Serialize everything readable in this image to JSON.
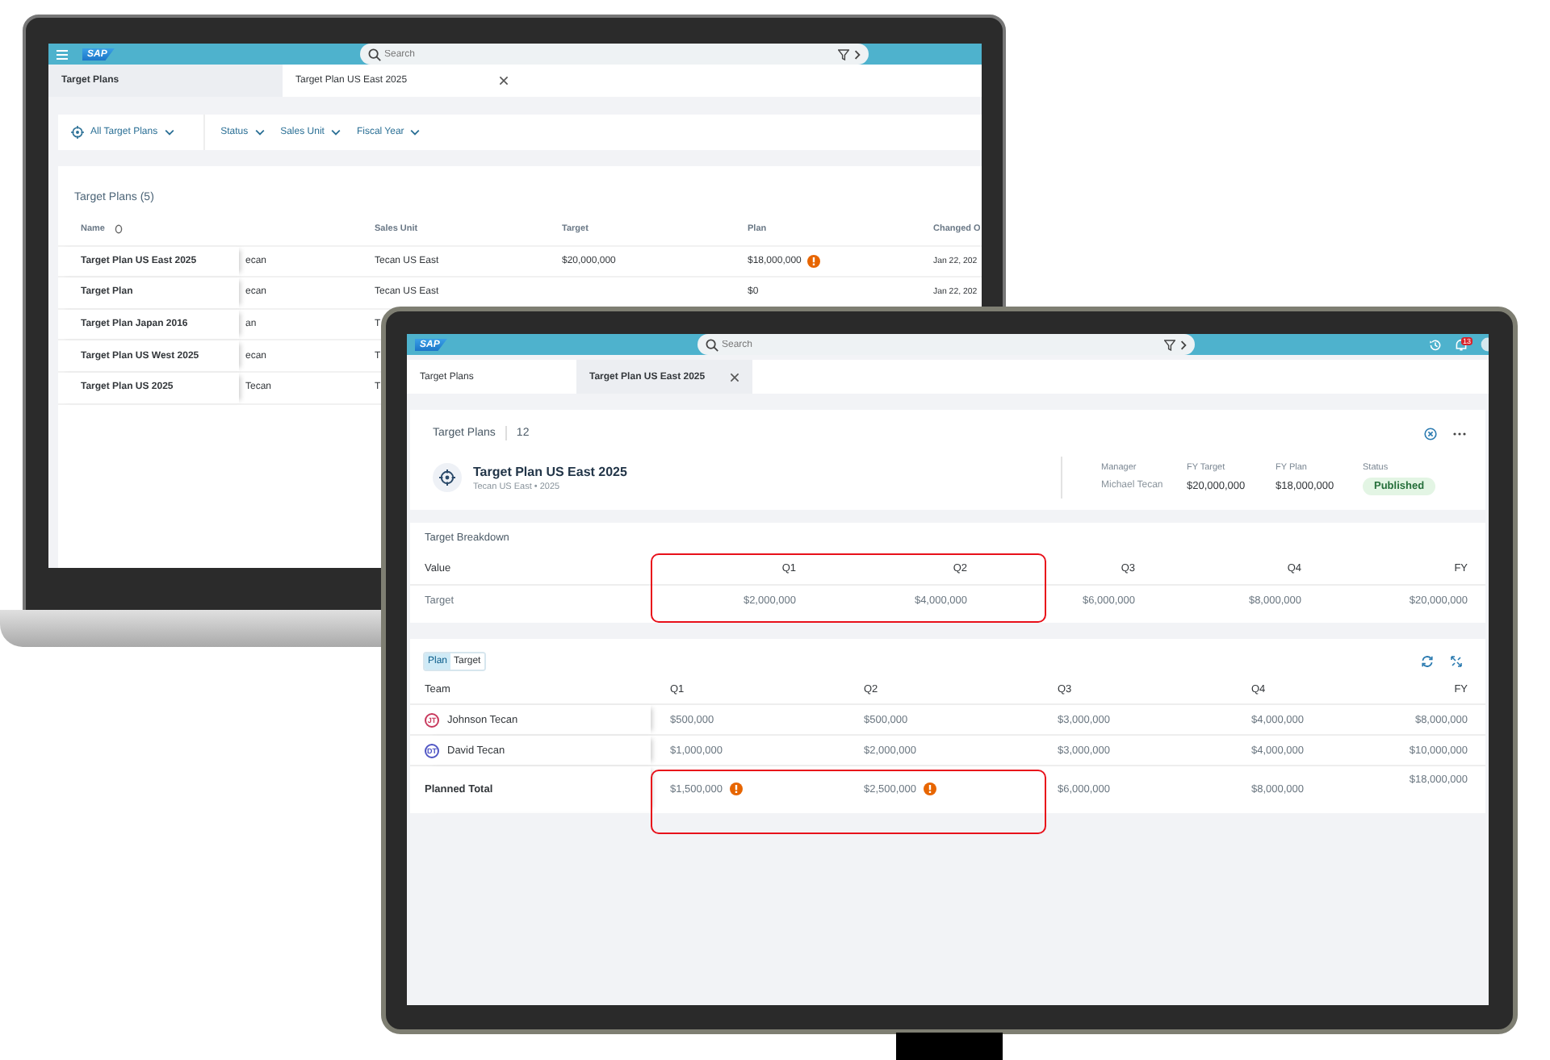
{
  "back_screen": {
    "shell": {
      "logo": "SAP",
      "search_placeholder": "Search"
    },
    "tabs": [
      {
        "label": "Target Plans",
        "selected": true,
        "closable": false
      },
      {
        "label": "Target Plan US East 2025",
        "selected": false,
        "closable": true
      }
    ],
    "filters": [
      {
        "kind": "variant",
        "label": "All Target Plans"
      },
      {
        "kind": "filter",
        "label": "Status"
      },
      {
        "kind": "filter",
        "label": "Sales Unit"
      },
      {
        "kind": "filter",
        "label": "Fiscal Year"
      }
    ],
    "table": {
      "title": "Target Plans (5)",
      "columns": {
        "name": "Name",
        "sales_unit": "Sales Unit",
        "target": "Target",
        "plan": "Plan",
        "changed_on": "Changed O"
      },
      "rows": [
        {
          "name": "Target Plan US East 2025",
          "column_2": "ecan",
          "sales_unit": "Tecan US East",
          "target": "$20,000,000",
          "plan": {
            "text": "$18,000,000",
            "warning": true
          },
          "changed_on": "Jan 22, 202"
        },
        {
          "name": "Target Plan",
          "column_2": "ecan",
          "sales_unit": "Tecan US East",
          "plan": {
            "text": "$0",
            "warning": false
          },
          "changed_on": "Jan 22, 202"
        },
        {
          "name": "Target Plan Japan 2016",
          "column_2": "an",
          "sales_unit": "T"
        },
        {
          "name": "Target Plan US West 2025",
          "column_2": "ecan",
          "sales_unit": "T"
        },
        {
          "name": "Target Plan US 2025",
          "column_2": "Tecan",
          "sales_unit": "T"
        }
      ]
    }
  },
  "front_screen": {
    "shell": {
      "logo": "SAP",
      "search_placeholder": "Search",
      "notification_count": "13"
    },
    "tabs": [
      {
        "label": "Target Plans",
        "selected": false,
        "closable": false
      },
      {
        "label": "Target Plan US East 2025",
        "selected": true,
        "closable": true
      }
    ],
    "header": {
      "breadcrumb": "Target Plans",
      "count": "12",
      "title": "Target Plan US East 2025",
      "subtitle": "Tecan US East • 2025",
      "attributes": [
        {
          "label": "Manager",
          "value": "Michael Tecan"
        },
        {
          "label": "FY Target",
          "value": "$20,000,000"
        },
        {
          "label": "FY Plan",
          "value": "$18,000,000"
        }
      ],
      "status": {
        "label": "Status",
        "value": "Published"
      }
    },
    "breakdown": {
      "title": "Target Breakdown",
      "columns": [
        "Value",
        "Q1",
        "Q2",
        "Q3",
        "Q4",
        "FY"
      ],
      "rows": [
        [
          "Target",
          "$2,000,000",
          "$4,000,000",
          "$6,000,000",
          "$8,000,000",
          "$20,000,000"
        ]
      ]
    },
    "plan": {
      "toggle": [
        {
          "label": "Plan",
          "selected": true
        },
        {
          "label": "Target",
          "selected": false
        }
      ],
      "columns": [
        "Team",
        "Q1",
        "Q2",
        "Q3",
        "Q4",
        "FY"
      ],
      "rows": [
        {
          "kind": "member",
          "initials": "JT",
          "color": "#c8385c",
          "name": "Johnson Tecan",
          "values": [
            {
              "text": "$500,000",
              "warning": false
            },
            {
              "text": "$500,000",
              "warning": false
            },
            {
              "text": "$3,000,000",
              "warning": false
            },
            {
              "text": "$4,000,000",
              "warning": false
            },
            {
              "text": "$8,000,000",
              "warning": false
            }
          ]
        },
        {
          "kind": "member",
          "initials": "DT",
          "color": "#4f55c4",
          "name": "David Tecan",
          "values": [
            {
              "text": "$1,000,000",
              "warning": false
            },
            {
              "text": "$2,000,000",
              "warning": false
            },
            {
              "text": "$3,000,000",
              "warning": false
            },
            {
              "text": "$4,000,000",
              "warning": false
            },
            {
              "text": "$10,000,000",
              "warning": false
            }
          ]
        },
        {
          "kind": "total",
          "name": "Planned Total",
          "values": [
            {
              "text": "$1,500,000",
              "warning": true
            },
            {
              "text": "$2,500,000",
              "warning": true
            },
            {
              "text": "$6,000,000",
              "warning": false
            },
            {
              "text": "$8,000,000",
              "warning": false
            },
            {
              "text": "$18,000,000",
              "warning": false
            }
          ]
        }
      ]
    }
  }
}
